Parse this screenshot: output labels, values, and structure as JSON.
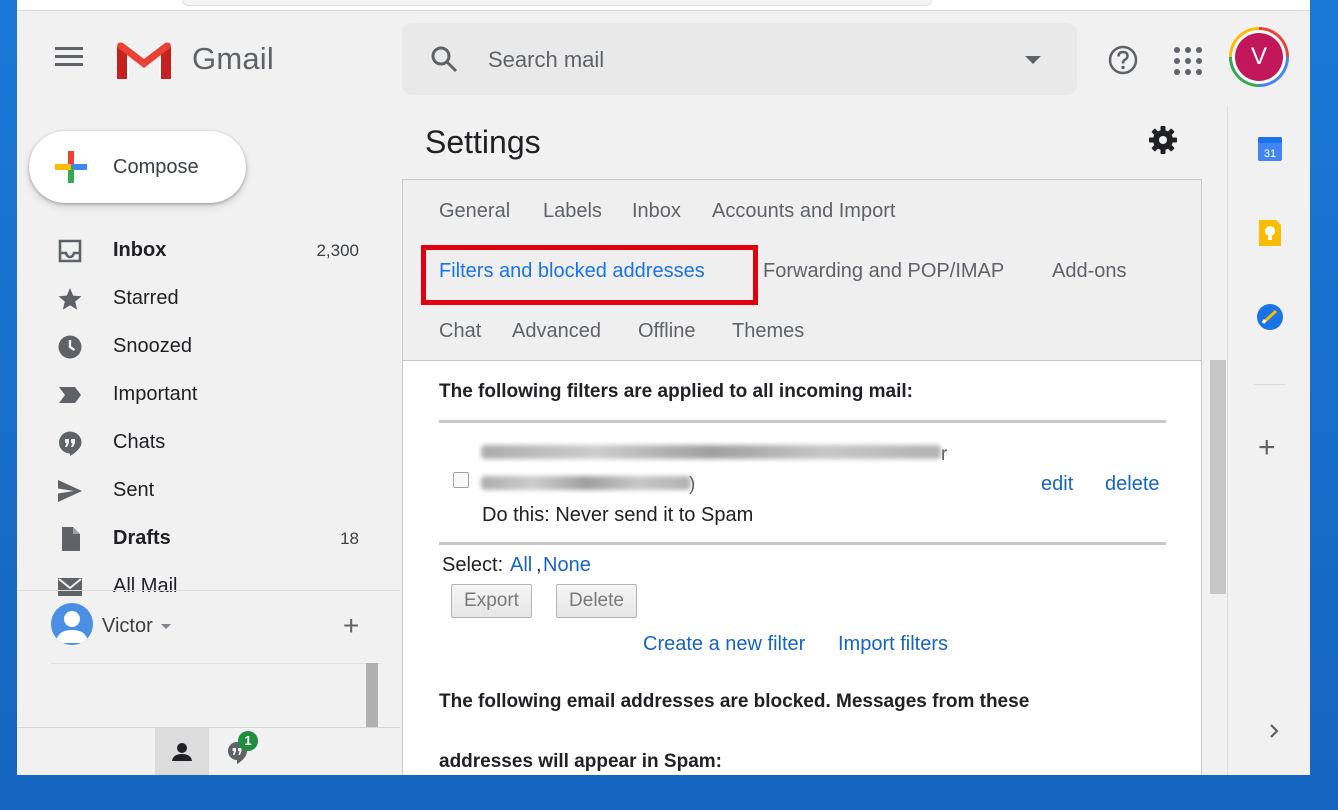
{
  "header": {
    "brand": "Gmail",
    "search_placeholder": "Search mail",
    "avatar_initial": "V"
  },
  "compose": {
    "label": "Compose"
  },
  "nav": {
    "items": [
      {
        "label": "Inbox",
        "count": "2,300",
        "icon": "inbox-icon",
        "bold": true
      },
      {
        "label": "Starred",
        "count": "",
        "icon": "star-icon",
        "bold": false
      },
      {
        "label": "Snoozed",
        "count": "",
        "icon": "clock-icon",
        "bold": false
      },
      {
        "label": "Important",
        "count": "",
        "icon": "important-icon",
        "bold": false
      },
      {
        "label": "Chats",
        "count": "",
        "icon": "chat-icon",
        "bold": false
      },
      {
        "label": "Sent",
        "count": "",
        "icon": "send-icon",
        "bold": false
      },
      {
        "label": "Drafts",
        "count": "18",
        "icon": "draft-icon",
        "bold": true
      },
      {
        "label": "All Mail",
        "count": "",
        "icon": "mail-icon",
        "bold": false
      }
    ]
  },
  "hangouts": {
    "user_name": "Victor",
    "chat_badge": "1"
  },
  "settings": {
    "title": "Settings",
    "tabs": {
      "general": "General",
      "labels": "Labels",
      "inbox": "Inbox",
      "accounts": "Accounts and Import",
      "filters": "Filters and blocked addresses",
      "forwarding": "Forwarding and POP/IMAP",
      "addons": "Add-ons",
      "chat": "Chat",
      "advanced": "Advanced",
      "offline": "Offline",
      "themes": "Themes"
    },
    "active_tab": "Filters and blocked addresses",
    "filters_heading": "The following filters are applied to all incoming mail:",
    "filter_row": {
      "action": "Do this: Never send it to Spam",
      "edit": "edit",
      "delete": "delete",
      "visible_fragment_1": "r",
      "visible_fragment_2": ")"
    },
    "select": {
      "label": "Select:",
      "all": "All",
      "sep": ",",
      "none": "None"
    },
    "buttons": {
      "export": "Export",
      "delete": "Delete"
    },
    "links": {
      "create": "Create a new filter",
      "import": "Import filters"
    },
    "blocked_heading_1": "The following email addresses are blocked. Messages from these",
    "blocked_heading_2": "addresses will appear in Spam:"
  },
  "right_sidebar": {
    "calendar_day": "31",
    "icons": [
      "calendar-icon",
      "keep-icon",
      "tasks-icon",
      "add-icon",
      "chevron-right-icon"
    ]
  },
  "colors": {
    "accent": "#1a73e8",
    "link": "#1565c0",
    "highlight_box": "#e0000f",
    "avatar_bg": "#c2185b",
    "desktop_bg": "#1a78d6"
  }
}
